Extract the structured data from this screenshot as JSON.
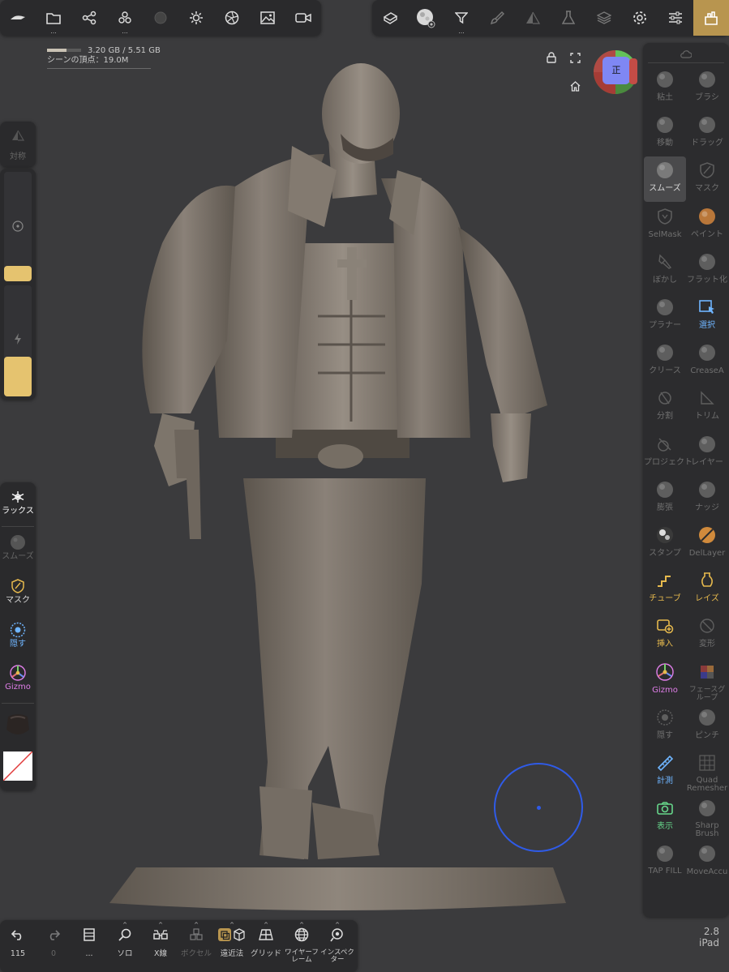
{
  "memory": {
    "usage": "3.20 GB / 5.51 GB",
    "used_fraction": 0.58,
    "vertices": "シーンの頂点：19.0M"
  },
  "gizmo": {
    "front_label": "正"
  },
  "right_tools": [
    {
      "label": "粘土",
      "icon": "clay-brush-icon",
      "state": "dim"
    },
    {
      "label": "ブラシ",
      "icon": "standard-brush-icon",
      "state": "dim"
    },
    {
      "label": "移動",
      "icon": "move-brush-icon",
      "state": "dim"
    },
    {
      "label": "ドラッグ",
      "icon": "drag-brush-icon",
      "state": "dim"
    },
    {
      "label": "スムーズ",
      "icon": "smooth-brush-icon",
      "state": "selected"
    },
    {
      "label": "マスク",
      "icon": "mask-icon",
      "state": "dim"
    },
    {
      "label": "SelMask",
      "icon": "selmask-icon",
      "state": "dim"
    },
    {
      "label": "ペイント",
      "icon": "paint-icon",
      "state": "dim"
    },
    {
      "label": "ぼかし",
      "icon": "smudge-icon",
      "state": "dim"
    },
    {
      "label": "フラット化",
      "icon": "flatten-icon",
      "state": "dim"
    },
    {
      "label": "プラナー",
      "icon": "planar-icon",
      "state": "dim"
    },
    {
      "label": "選択",
      "icon": "select-icon",
      "state": "blue"
    },
    {
      "label": "クリース",
      "icon": "crease-icon",
      "state": "dim"
    },
    {
      "label": "CreaseA",
      "icon": "crease-alpha-icon",
      "state": "dim"
    },
    {
      "label": "分割",
      "icon": "split-icon",
      "state": "dim"
    },
    {
      "label": "トリム",
      "icon": "trim-icon",
      "state": "dim"
    },
    {
      "label": "プロジェクト",
      "icon": "project-icon",
      "state": "dim"
    },
    {
      "label": "レイヤー",
      "icon": "layer-brush-icon",
      "state": "dim"
    },
    {
      "label": "膨張",
      "icon": "inflate-icon",
      "state": "dim"
    },
    {
      "label": "ナッジ",
      "icon": "nudge-icon",
      "state": "dim"
    },
    {
      "label": "スタンプ",
      "icon": "stamp-icon",
      "state": "dim"
    },
    {
      "label": "DelLayer",
      "icon": "del-layer-icon",
      "state": "dim"
    },
    {
      "label": "チューブ",
      "icon": "tube-icon",
      "state": "yellow"
    },
    {
      "label": "レイズ",
      "icon": "lathe-icon",
      "state": "yellow"
    },
    {
      "label": "挿入",
      "icon": "insert-icon",
      "state": "yellow"
    },
    {
      "label": "変形",
      "icon": "transform-icon",
      "state": "dim"
    },
    {
      "label": "Gizmo",
      "icon": "gizmo-icon",
      "state": "magenta"
    },
    {
      "label": "フェースグループ",
      "icon": "facegroup-icon",
      "state": "dim"
    },
    {
      "label": "隠す",
      "icon": "hide-icon",
      "state": "dim"
    },
    {
      "label": "ピンチ",
      "icon": "pinch-icon",
      "state": "dim"
    },
    {
      "label": "計測",
      "icon": "measure-icon",
      "state": "blue"
    },
    {
      "label": "Quad Remesher",
      "icon": "quad-remesher-icon",
      "state": "dim"
    },
    {
      "label": "表示",
      "icon": "view-camera-icon",
      "state": "green"
    },
    {
      "label": "Sharp Brush",
      "icon": "sharp-brush-icon",
      "state": "dim"
    },
    {
      "label": "TAP FILL",
      "icon": "tap-fill-icon",
      "state": "dim"
    },
    {
      "label": "MoveAccu",
      "icon": "move-accu-icon",
      "state": "dim"
    }
  ],
  "left": {
    "symmetry_label": "対称",
    "radius_level": 0.14,
    "intensity_level": 0.36,
    "relax_label": "リラックス",
    "smooth_label": "スムーズ",
    "mask_label": "マスク",
    "hide_label": "隠す",
    "gizmo_label": "Gizmo"
  },
  "bottom": [
    {
      "label": "115",
      "icon": "undo-icon",
      "dim": false
    },
    {
      "label": "0",
      "icon": "redo-icon",
      "dim": true
    },
    {
      "label": "...",
      "icon": "scene-menu-icon",
      "dim": false
    },
    {
      "label": "ソロ",
      "icon": "solo-search-icon",
      "dim": false
    },
    {
      "label": "X線",
      "icon": "xray-glasses-icon",
      "dim": false
    },
    {
      "label": "ボクセル",
      "icon": "voxel-icon",
      "dim": true
    },
    {
      "label": "遠近法",
      "icon": "perspective-icon",
      "dim": false
    },
    {
      "label": "グリッド",
      "icon": "grid-icon",
      "dim": false
    },
    {
      "label": "ワイヤーフレーム",
      "icon": "wireframe-icon",
      "dim": false
    },
    {
      "label": "インスペクター",
      "icon": "inspector-icon",
      "dim": false
    }
  ],
  "device": {
    "version": "2.8",
    "name": "iPad"
  },
  "colors": {
    "accent_yellow": "#e5c36f",
    "active_tab": "#b8954f",
    "brush_circle": "#2f5be8",
    "sculpt_clay": "#8a8178"
  }
}
